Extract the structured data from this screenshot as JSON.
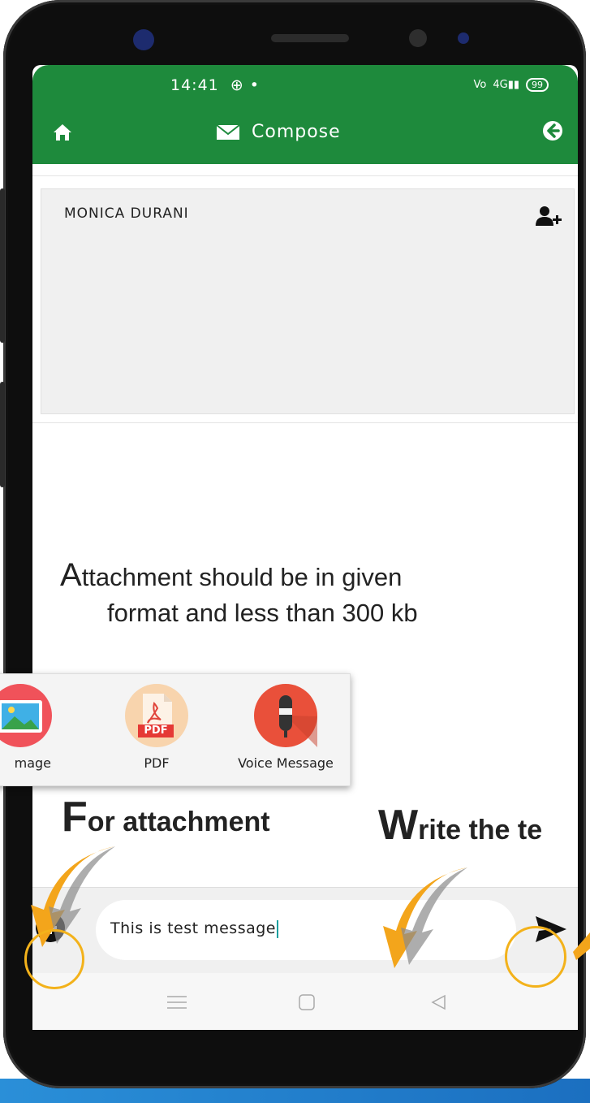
{
  "status_bar": {
    "time": "14:41",
    "network": "4G",
    "battery": "99"
  },
  "header": {
    "title": "Compose"
  },
  "recipients": {
    "name": "MONICA DURANI"
  },
  "annotation": {
    "first_letter": "A",
    "line1": "ttachment should be in given",
    "line2": "format and less than 300 kb"
  },
  "attachment_menu": {
    "items": [
      {
        "label": "Image",
        "icon": "image-icon"
      },
      {
        "label": "PDF",
        "icon": "pdf-icon"
      },
      {
        "label": "Voice Message",
        "icon": "microphone-icon"
      }
    ],
    "visible_image_label": "mage",
    "pdf_badge": "PDF"
  },
  "callouts": {
    "attachment_cap": "F",
    "attachment_rest": "or attachment",
    "write_cap": "W",
    "write_rest": "rite the te"
  },
  "composer": {
    "message_value": "This is test message"
  },
  "colors": {
    "header_green": "#1e8a3c",
    "annotation_orange": "#f3b21b",
    "bottom_strip_blue": "#1b6fc0"
  }
}
